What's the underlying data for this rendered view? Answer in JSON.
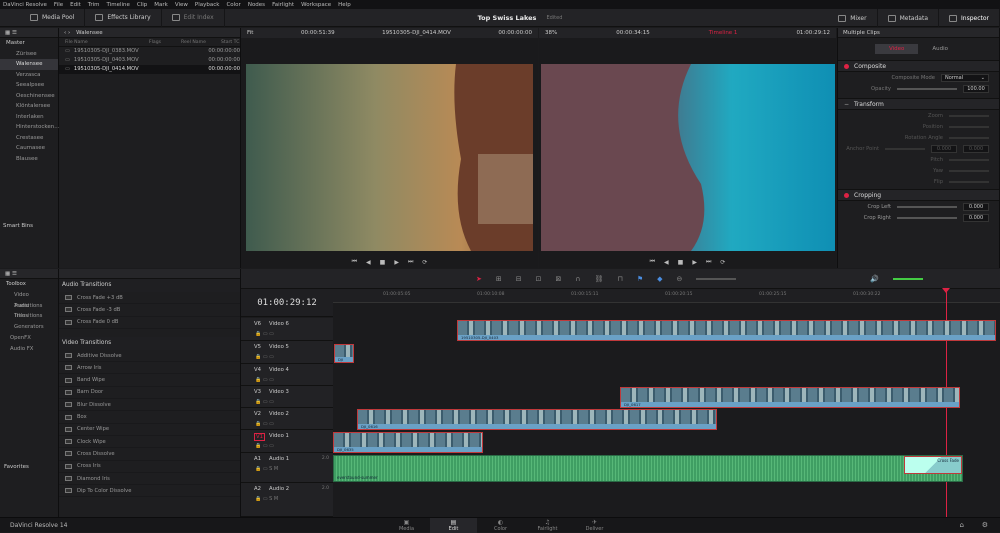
{
  "menu": [
    "DaVinci Resolve",
    "File",
    "Edit",
    "Trim",
    "Timeline",
    "Clip",
    "Mark",
    "View",
    "Playback",
    "Color",
    "Nodes",
    "Fairlight",
    "Workspace",
    "Help"
  ],
  "toolbar": {
    "media_pool": "Media Pool",
    "effects_library": "Effects Library",
    "edit_index": "Edit Index",
    "mixer": "Mixer",
    "metadata": "Metadata",
    "inspector": "Inspector"
  },
  "project": {
    "title": "Top Swiss Lakes",
    "status": "Edited"
  },
  "media_pool": {
    "current_bin": "Walensee",
    "root": "Master",
    "bins": [
      "Zürisee",
      "Walensee",
      "Verzasca",
      "Seealpsee",
      "Oeschinensee",
      "Klöntalersee",
      "Interlaken",
      "Hinterstocken...",
      "Crestasee",
      "Caumasee",
      "Blausee"
    ],
    "smart_bins": "Smart Bins",
    "columns": [
      "File Name",
      "Flags",
      "Reel Name",
      "Start TC"
    ],
    "files": [
      {
        "name": "19510305-DJI_0383.MOV",
        "tc": "00:00:00:00"
      },
      {
        "name": "19510305-DJI_0403.MOV",
        "tc": "00:00:00:00"
      },
      {
        "name": "19510305-DJI_0414.MOV",
        "tc": "00:00:00:00"
      }
    ]
  },
  "source_viewer": {
    "zoom": "Fit",
    "duration": "00:00:51:39",
    "clip": "19510305-DJI_0414.MOV",
    "timecode": "00:00:00:00"
  },
  "timeline_viewer": {
    "zoom": "38%",
    "duration": "00:00:34:15",
    "timeline": "Timeline 1",
    "timecode": "01:00:29:12"
  },
  "inspector": {
    "title": "Multiple Clips",
    "tabs": [
      "Video",
      "Audio"
    ],
    "composite": "Composite",
    "composite_mode_label": "Composite Mode",
    "composite_mode": "Normal",
    "opacity_label": "Opacity",
    "opacity": "100.00",
    "transform": "Transform",
    "transform_rows": [
      "Zoom",
      "Position",
      "Rotation Angle",
      "Anchor Point",
      "Pitch",
      "Yaw",
      "Flip"
    ],
    "anchor_values": [
      "0.000",
      "0.000"
    ],
    "cropping": "Cropping",
    "crop_left_label": "Crop Left",
    "crop_left": "0.000",
    "crop_right_label": "Crop Right",
    "crop_right": "0.000"
  },
  "toolbox": {
    "title": "Toolbox",
    "items": [
      "Video Transitions",
      "Audio Transitions",
      "Titles",
      "Generators"
    ],
    "extra": [
      "OpenFX",
      "Audio FX"
    ],
    "favorites": "Favorites"
  },
  "effects": {
    "audio_title": "Audio Transitions",
    "audio_items": [
      "Cross Fade +3 dB",
      "Cross Fade -3 dB",
      "Cross Fade 0 dB"
    ],
    "video_title": "Video Transitions",
    "video_items": [
      "Additive Dissolve",
      "Arrow Iris",
      "Band Wipe",
      "Barn Door",
      "Blur Dissolve",
      "Box",
      "Center Wipe",
      "Clock Wipe",
      "Cross Dissolve",
      "Cross Iris",
      "Diamond Iris",
      "Dip To Color Dissolve"
    ]
  },
  "timeline": {
    "timecode": "01:00:29:12",
    "ruler": [
      "01:00:05:05",
      "01:00:10:08",
      "01:00:15:11",
      "01:00:20:15",
      "01:00:25:15",
      "01:00:30:22"
    ],
    "tracks": [
      {
        "id": "V6",
        "name": "Video 6"
      },
      {
        "id": "V5",
        "name": "Video 5"
      },
      {
        "id": "V4",
        "name": "Video 4"
      },
      {
        "id": "V3",
        "name": "Video 3"
      },
      {
        "id": "V2",
        "name": "Video 2"
      },
      {
        "id": "V1",
        "name": "Video 1"
      },
      {
        "id": "A1",
        "name": "Audio 1",
        "ch": "2.0"
      },
      {
        "id": "A2",
        "name": "Audio 2",
        "ch": "2.0"
      }
    ],
    "clips": {
      "v6": "19510305-DJI_0403",
      "v5": "DJI",
      "v3": "DJI_0617",
      "v2": "DJI_0616",
      "v1": "DJI_0635",
      "a1": "everstound-summer",
      "a1_trans": "Cross Fade"
    }
  },
  "pages": [
    "Media",
    "Edit",
    "Color",
    "Fairlight",
    "Deliver"
  ],
  "app_name": "DaVinci Resolve 14"
}
